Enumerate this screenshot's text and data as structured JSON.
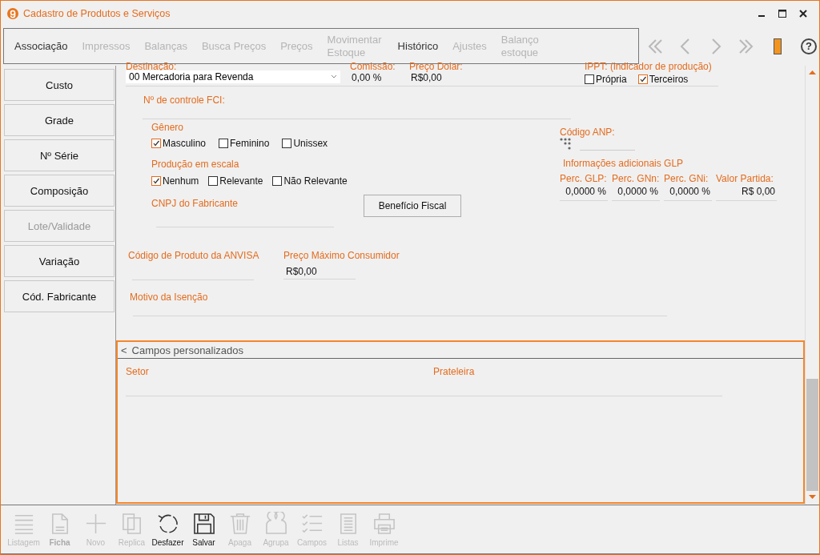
{
  "window": {
    "title": "Cadastro de Produtos e Serviços"
  },
  "tabs": [
    {
      "label": "Associação",
      "disabled": false
    },
    {
      "label": "Impressos",
      "disabled": true
    },
    {
      "label": "Balanças",
      "disabled": true
    },
    {
      "label": "Busca Preços",
      "disabled": true
    },
    {
      "label": "Preços",
      "disabled": true
    },
    {
      "label": "Movimentar Estoque",
      "disabled": true
    },
    {
      "label": "Histórico",
      "disabled": false
    },
    {
      "label": "Ajustes",
      "disabled": true
    },
    {
      "label": "Balanço estoque",
      "disabled": true
    }
  ],
  "help": "?",
  "sidebar": [
    {
      "label": "Custo",
      "disabled": false
    },
    {
      "label": "Grade",
      "disabled": false
    },
    {
      "label": "Nº Série",
      "disabled": false
    },
    {
      "label": "Composição",
      "disabled": false
    },
    {
      "label": "Lote/Validade",
      "disabled": true
    },
    {
      "label": "Variação",
      "disabled": false
    },
    {
      "label": "Cód. Fabricante",
      "disabled": false
    }
  ],
  "form": {
    "destinacao": {
      "label": "Destinação:",
      "value": "00 Mercadoria para Revenda"
    },
    "comissao": {
      "label": "Comissão:",
      "value": "0,00 %"
    },
    "preco_dolar": {
      "label": "Preço Dolar:",
      "value": "R$0,00"
    },
    "ippt": {
      "label": "IPPT: (indicador de produção)",
      "options": [
        {
          "label": "Própria",
          "checked": false
        },
        {
          "label": "Terceiros",
          "checked": true
        }
      ]
    },
    "fci": {
      "label": "Nº de controle FCI:"
    },
    "genero": {
      "label": "Gênero",
      "options": [
        {
          "label": "Masculino",
          "checked": true
        },
        {
          "label": "Feminino",
          "checked": false
        },
        {
          "label": "Unissex",
          "checked": false
        }
      ]
    },
    "producao": {
      "label": "Produção em escala",
      "options": [
        {
          "label": "Nenhum",
          "checked": true
        },
        {
          "label": "Relevante",
          "checked": false
        },
        {
          "label": "Não Relevante",
          "checked": false
        }
      ]
    },
    "cnpj": {
      "label": "CNPJ do Fabricante"
    },
    "beneficio_button": "Benefício Fiscal",
    "anp": {
      "label": "Código ANP:"
    },
    "glp": {
      "label": "Informações adicionais GLP",
      "fields": [
        {
          "label": "Perc. GLP:",
          "value": "0,0000 %"
        },
        {
          "label": "Perc. GNn:",
          "value": "0,0000 %"
        },
        {
          "label": "Perc. GNi:",
          "value": "0,0000 %"
        },
        {
          "label": "Valor Partida:",
          "value": "R$ 0,00"
        }
      ]
    },
    "anvisa": {
      "label": "Código de Produto da ANVISA"
    },
    "preco_maximo": {
      "label": "Preço Máximo Consumidor",
      "value": "R$0,00"
    },
    "motivo": {
      "label": "Motivo da Isenção"
    }
  },
  "custom_fields": {
    "toggle": "<",
    "title": "Campos personalizados",
    "fields": [
      {
        "label": "Setor"
      },
      {
        "label": "Prateleira"
      }
    ]
  },
  "toolbar": [
    {
      "kind": "list",
      "label": "Listagem",
      "disabled": true,
      "selected": false
    },
    {
      "kind": "document",
      "label": "Ficha",
      "disabled": true,
      "selected": true
    },
    {
      "kind": "plus",
      "label": "Novo",
      "disabled": true,
      "selected": false
    },
    {
      "kind": "copy",
      "label": "Replica",
      "disabled": true,
      "selected": false
    },
    {
      "kind": "undo",
      "label": "Desfazer",
      "disabled": false,
      "selected": false
    },
    {
      "kind": "save",
      "label": "Salvar",
      "disabled": false,
      "selected": false
    },
    {
      "kind": "trash",
      "label": "Apaga",
      "disabled": true,
      "selected": false
    },
    {
      "kind": "group",
      "label": "Agrupa",
      "disabled": true,
      "selected": false
    },
    {
      "kind": "checklist",
      "label": "Campos",
      "disabled": true,
      "selected": false
    },
    {
      "kind": "lines",
      "label": "Listas",
      "disabled": true,
      "selected": false
    },
    {
      "kind": "printer",
      "label": "Imprime",
      "disabled": true,
      "selected": false
    }
  ]
}
